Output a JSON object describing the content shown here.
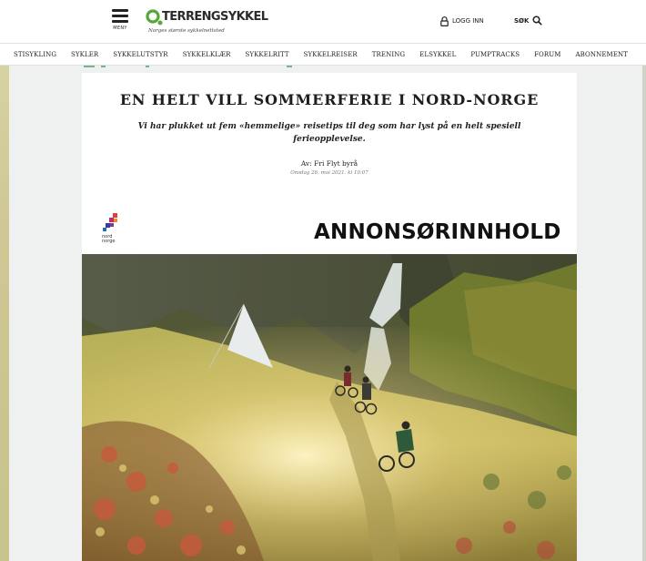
{
  "header": {
    "menu_label": "MENY",
    "logo_text": "TERRENGSYKKEL",
    "logo_tagline": "Norges største sykkelnettsted",
    "login_label": "LOGG INN",
    "search_label": "SØK"
  },
  "nav": {
    "items": [
      "STISYKLING",
      "SYKLER",
      "SYKKELUTSTYR",
      "SYKKELKLÆR",
      "SYKKELRITT",
      "SYKKELREISER",
      "TRENING",
      "ELSYKKEL",
      "PUMPTRACKS",
      "FORUM",
      "ABONNEMENT"
    ]
  },
  "article": {
    "title": "EN HELT VILL SOMMERFERIE I NORD-NORGE",
    "lead": "Vi har plukket ut fem «hemmelige» reisetips til deg som har lyst på en helt spesiell ferieopplevelse.",
    "byline": "Av: Fri Flyt byrå",
    "date": "Onsdag 26. mai 2021. kl 10:07",
    "ad_label": "ANNONSØRINNHOLD",
    "sponsor_name": "nord\nnorge"
  },
  "colors": {
    "brand_green": "#57a83a",
    "background": "#eef1ef"
  }
}
